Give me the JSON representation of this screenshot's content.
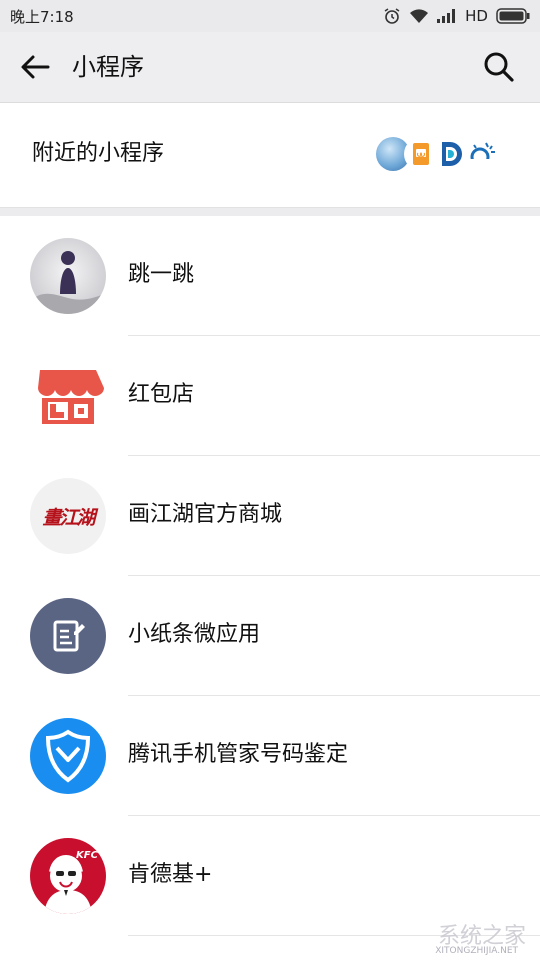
{
  "status_bar": {
    "time": "晚上7:18",
    "network": "HD"
  },
  "header": {
    "title": "小程序"
  },
  "nearby": {
    "label": "附近的小程序"
  },
  "apps": [
    {
      "name": "跳一跳",
      "icon": "jump-jump-icon"
    },
    {
      "name": "红包店",
      "icon": "red-shop-icon"
    },
    {
      "name": "画江湖官方商城",
      "icon": "hua-jianghu-icon",
      "icon_text": "畫江湖"
    },
    {
      "name": "小纸条微应用",
      "icon": "note-icon"
    },
    {
      "name": "腾讯手机管家号码鉴定",
      "icon": "tencent-shield-icon"
    },
    {
      "name": "肯德基+",
      "icon": "kfc-icon",
      "icon_text": "KFC"
    }
  ],
  "watermark": {
    "text": "系统之家",
    "url": "XITONGZHIJIA.NET"
  },
  "colors": {
    "red_shop": "#e8564a",
    "note_bg": "#5a6584",
    "tencent_blue": "#1a8ef0",
    "kfc_red": "#c8102e"
  }
}
